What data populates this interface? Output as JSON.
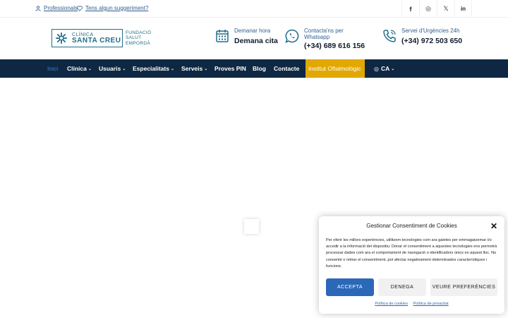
{
  "topbar": {
    "professionals": "Professionals",
    "suggestion": "Tens algun suggeriment?",
    "social": [
      "f",
      "◎",
      "𝕏",
      "in"
    ]
  },
  "logo": {
    "line1": "CLÍNICA",
    "line2": "SANTA CREU",
    "fund1": "FUNDACIÓ",
    "fund2": "SALUT",
    "fund3": "EMPORDÀ"
  },
  "contacts": [
    {
      "small": "Demanar hora",
      "big": "Demana cita"
    },
    {
      "small": "Contacta'ns per Whatsapp",
      "big": "(+34) 689 616 156"
    },
    {
      "small": "Servei d'Urgències 24h",
      "big": "(+34) 972 503 650"
    }
  ],
  "nav": {
    "items": [
      "Inici",
      "Clínica",
      "Usuaris",
      "Especialitats",
      "Serveis",
      "Proves PIN",
      "Blog",
      "Contacte",
      "Institut Oftalmològic"
    ],
    "lang": "CA"
  },
  "cookie": {
    "title": "Gestionar Consentiment de Cookies",
    "body": "Per oferir les millors experiències, utilitzem tecnologies com ara galetes per emmagatzemar i/o accedir a la informació del dispositiu. Donar el consentiment a aquestes tecnologies ens permetrà processar dades com ara el comportament de navegació o identificadors únics en aquest lloc. No consentir o retirar el consentiment, pot afectar negativament determinades característiques i funcions.",
    "accept": "ACCEPTA",
    "deny": "DENEGA",
    "prefs": "VEURE PREFERÈNCIES",
    "cookie_policy": "Política de cookies",
    "privacy_policy": "Política de privacitat"
  },
  "colors": {
    "nav_bg": "#0e2844",
    "accent": "#3c7fc6",
    "highlight": "#e0a800",
    "brand": "#1f6d8a",
    "button": "#2c68b8"
  }
}
